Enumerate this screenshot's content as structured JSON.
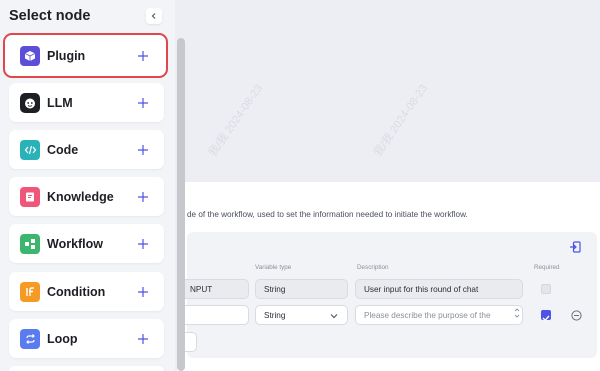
{
  "sidebar": {
    "title": "Select node",
    "nodes": [
      {
        "label": "Plugin",
        "icon": "plugin-icon",
        "color": "#5a4fd6"
      },
      {
        "label": "LLM",
        "icon": "llm-icon",
        "color": "#1d1f24"
      },
      {
        "label": "Code",
        "icon": "code-icon",
        "color": "#29b3b8"
      },
      {
        "label": "Knowledge",
        "icon": "knowledge-icon",
        "color": "#f0557a"
      },
      {
        "label": "Workflow",
        "icon": "workflow-icon",
        "color": "#3cb56e"
      },
      {
        "label": "Condition",
        "icon": "condition-icon",
        "color": "#f59a23"
      },
      {
        "label": "Loop",
        "icon": "loop-icon",
        "color": "#5b7cf0"
      }
    ],
    "selected_index": 0
  },
  "panel": {
    "description": "de of the workflow, used to set the information needed to initiate the workflow.",
    "headers": {
      "type": "Variable type",
      "description": "Description",
      "required": "Required"
    },
    "rows": [
      {
        "name": "NPUT",
        "type": "String",
        "description": "User input for this round of chat",
        "required": true,
        "required_disabled": true
      },
      {
        "name": "",
        "type": "String",
        "description_placeholder": "Please describe the purpose of the",
        "required": true,
        "required_disabled": false
      }
    ]
  },
  "watermarks": [
    "我/我 2024-08-23",
    "我/我 2024-08-23"
  ],
  "colors": {
    "accent": "#4d53e8",
    "selected_outline": "#e0464b"
  }
}
